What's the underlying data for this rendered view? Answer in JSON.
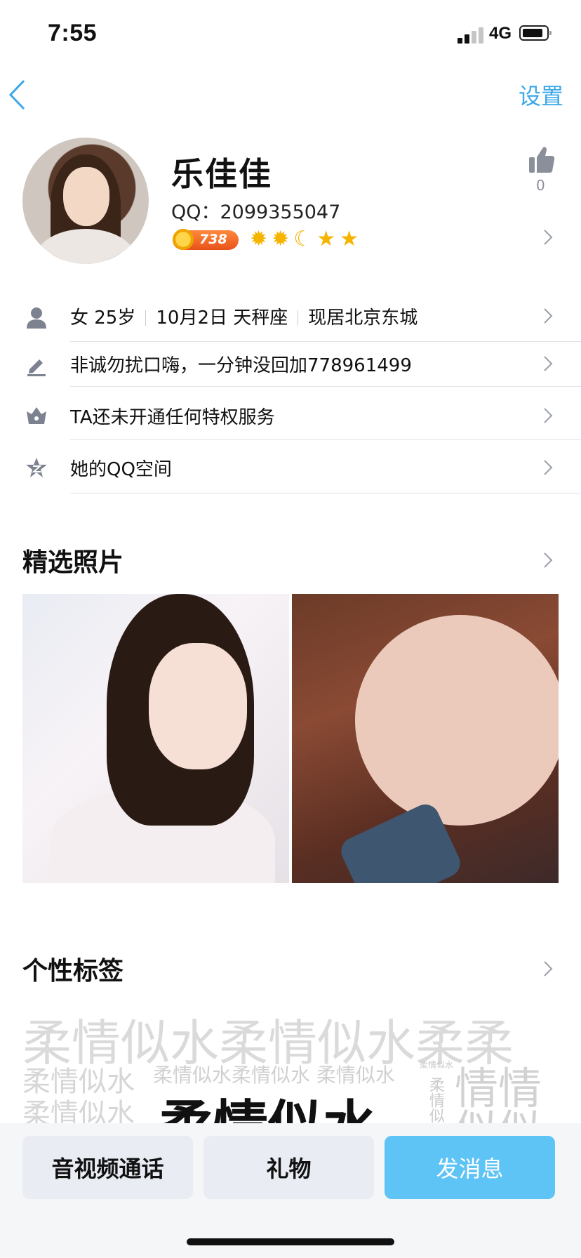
{
  "status_bar": {
    "time": "7:55",
    "network": "4G"
  },
  "nav": {
    "settings_label": "设置"
  },
  "profile": {
    "name": "乐佳佳",
    "qq": "QQ：2099355047",
    "level_value": "738",
    "like_count": "0"
  },
  "info_rows": {
    "basic": {
      "gender_age": "女 25岁",
      "birthday": "10月2日 天秤座",
      "location": "现居北京东城"
    },
    "signature": "非诚勿扰口嗨，一分钟没回加778961499",
    "privilege": "TA还未开通任何特权服务",
    "qzone": "她的QQ空间"
  },
  "sections": {
    "photos_title": "精选照片",
    "tags_title": "个性标签"
  },
  "tags": {
    "big1": "柔情似水柔情似水柔柔",
    "mid_row": "柔情似水",
    "small_row": "柔情似水柔情似水 柔情似水",
    "tiny": "柔情似水",
    "right1": "情情",
    "vert": "柔情似",
    "left3": "柔情似水",
    "bold": "柔情似水",
    "right2": "似似"
  },
  "bottom_buttons": {
    "call": "音视频通话",
    "gift": "礼物",
    "message": "发消息"
  },
  "colors": {
    "accent": "#3aa8e8",
    "primary_button": "#5ec3f5",
    "divider": "#e2e3e6"
  },
  "icons": [
    "back-icon",
    "thumbs-up-icon",
    "person-icon",
    "pencil-icon",
    "crown-icon",
    "qzone-star-icon",
    "chevron-right-icon"
  ]
}
